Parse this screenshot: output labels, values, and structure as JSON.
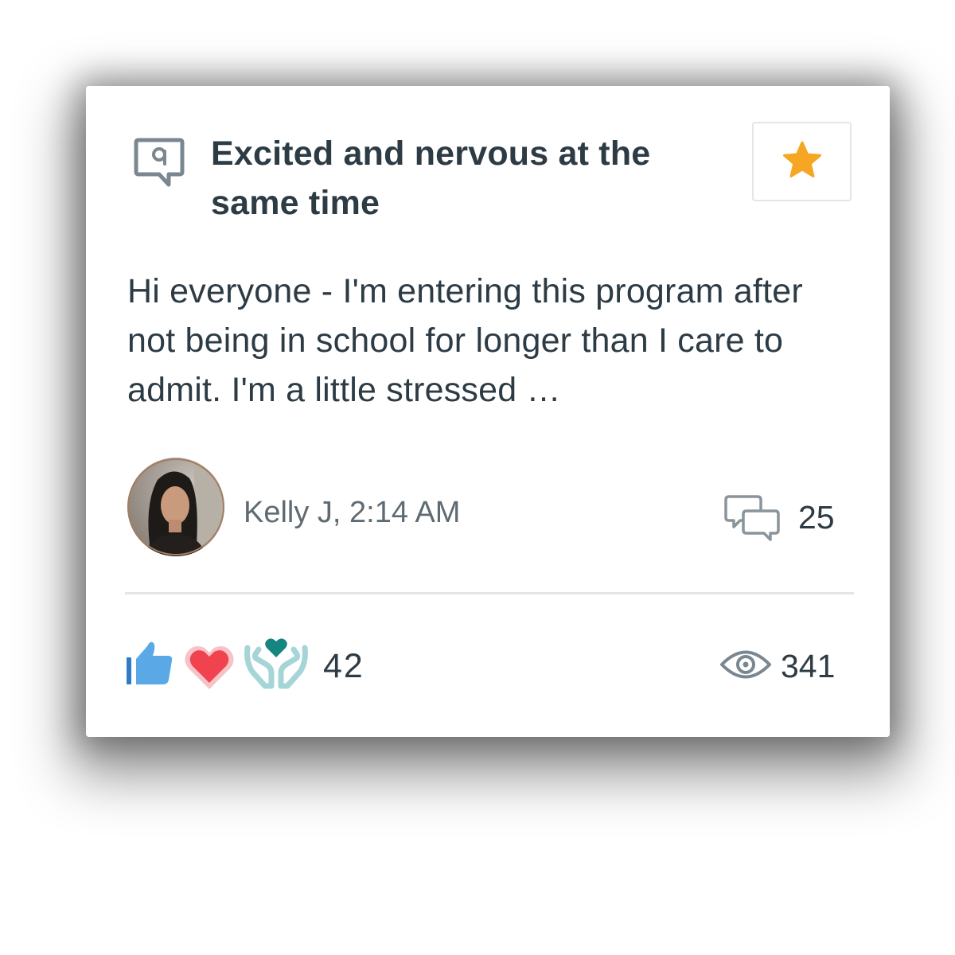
{
  "post": {
    "title": "Excited and nervous at the same time",
    "body": "Hi everyone - I'm entering this program after not being in school for longer than I care to admit. I'm a little stressed …",
    "author_line": "Kelly J, 2:14 AM",
    "reply_count": "25",
    "reaction_count": "42",
    "view_count": "341"
  },
  "icons": {
    "question": "question-bubble-icon",
    "favorite": "star-icon",
    "replies": "chat-bubbles-icon",
    "like": "thumbs-up-icon",
    "love": "heart-icon",
    "care": "hands-heart-icon",
    "views": "eye-icon"
  },
  "colors": {
    "text": "#2d3b45",
    "muted": "#5f6b73",
    "star": "#f5a623",
    "like": "#5aa9e6",
    "heart": "#f0434f",
    "care_heart": "#14857f",
    "care_hands": "#a6d5d8"
  }
}
